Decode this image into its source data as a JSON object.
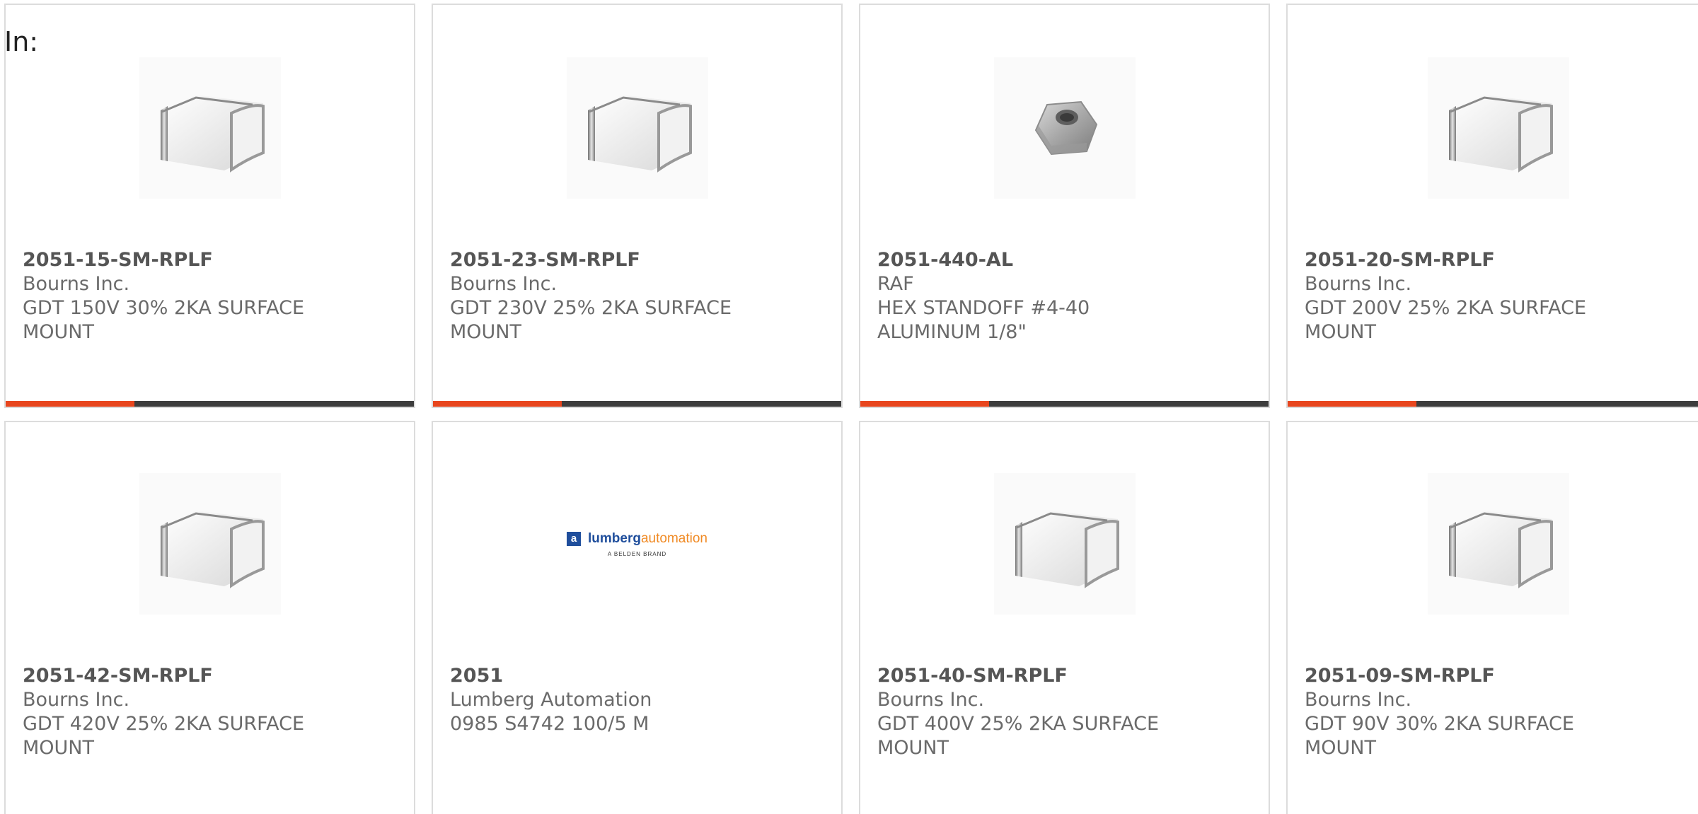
{
  "header": {
    "in_label": "In:"
  },
  "colors": {
    "accent": "#e8461e",
    "bar": "#3d3d3d",
    "border": "#dcdcdc"
  },
  "products": [
    {
      "part_number": "2051-15-SM-RPLF",
      "manufacturer": "Bourns Inc.",
      "description": "GDT 150V 30% 2KA SURFACE MOUNT",
      "image": "gdt-component-icon"
    },
    {
      "part_number": "2051-23-SM-RPLF",
      "manufacturer": "Bourns Inc.",
      "description": "GDT 230V 25% 2KA SURFACE MOUNT",
      "image": "gdt-component-icon"
    },
    {
      "part_number": "2051-440-AL",
      "manufacturer": "RAF",
      "description": "HEX STANDOFF #4-40 ALUMINUM 1/8\"",
      "image": "hex-nut-icon"
    },
    {
      "part_number": "2051-20-SM-RPLF",
      "manufacturer": "Bourns Inc.",
      "description": "GDT 200V 25% 2KA SURFACE MOUNT",
      "image": "gdt-component-icon"
    },
    {
      "part_number": "2051-42-SM-RPLF",
      "manufacturer": "Bourns Inc.",
      "description": "GDT 420V 25% 2KA SURFACE MOUNT",
      "image": "gdt-component-icon"
    },
    {
      "part_number": "2051",
      "manufacturer": "Lumberg Automation",
      "description": "0985 S4742 100/5 M",
      "image": "lumberg-logo"
    },
    {
      "part_number": "2051-40-SM-RPLF",
      "manufacturer": "Bourns Inc.",
      "description": "GDT 400V 25% 2KA SURFACE MOUNT",
      "image": "gdt-component-icon"
    },
    {
      "part_number": "2051-09-SM-RPLF",
      "manufacturer": "Bourns Inc.",
      "description": "GDT 90V 30% 2KA SURFACE MOUNT",
      "image": "gdt-component-icon"
    }
  ],
  "logo": {
    "box_letter": "a",
    "brand_bold": "lumberg",
    "brand_light": "automation",
    "tagline": "A BELDEN BRAND"
  }
}
